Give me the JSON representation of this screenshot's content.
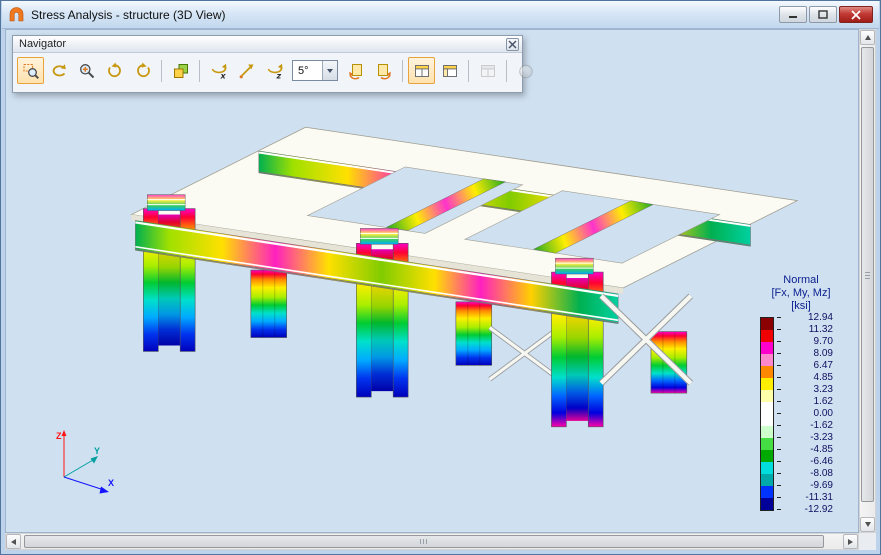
{
  "window": {
    "title": "Stress Analysis - structure (3D View)"
  },
  "navigator": {
    "title": "Navigator",
    "angle_value": "5°",
    "rotate_x_label": "x",
    "rotate_z_label": "z",
    "buttons": [
      {
        "name": "zoom-window",
        "state": "active"
      },
      {
        "name": "orbit",
        "state": "normal"
      },
      {
        "name": "zoom-in",
        "state": "normal"
      },
      {
        "name": "rotate-view-ccw",
        "state": "normal"
      },
      {
        "name": "rotate-view-cw",
        "state": "normal"
      },
      {
        "name": "display-layers",
        "state": "normal"
      },
      {
        "name": "rotate-about-x",
        "state": "normal"
      },
      {
        "name": "free-rotation",
        "state": "normal"
      },
      {
        "name": "rotate-about-z",
        "state": "normal"
      },
      {
        "name": "rotation-angle",
        "state": "normal",
        "value": "5°"
      },
      {
        "name": "rotate-left",
        "state": "normal"
      },
      {
        "name": "rotate-right",
        "state": "normal"
      },
      {
        "name": "view-isometric",
        "state": "active"
      },
      {
        "name": "view-parallel",
        "state": "normal"
      },
      {
        "name": "view-plane",
        "state": "disabled"
      },
      {
        "name": "full-model-view",
        "state": "disabled"
      }
    ]
  },
  "legend": {
    "title_line1": "Normal",
    "title_line2": "[Fx, My, Mz]",
    "title_line3": "[ksi]",
    "values": [
      "12.94",
      "11.32",
      "9.70",
      "8.09",
      "6.47",
      "4.85",
      "3.23",
      "1.62",
      "0.00",
      "-1.62",
      "-3.23",
      "-4.85",
      "-6.46",
      "-8.08",
      "-9.69",
      "-11.31",
      "-12.92"
    ],
    "band_colors": [
      "#8b0000",
      "#f00000",
      "#ff00cc",
      "#ff88cc",
      "#ff8800",
      "#ffee00",
      "#ffffaa",
      "#ffffff",
      "#ffffff",
      "#ccffcc",
      "#44dd44",
      "#00aa00",
      "#00dddd",
      "#00aaaa",
      "#0033ff",
      "#000099"
    ]
  },
  "axes": {
    "x_label": "X",
    "y_label": "Y",
    "z_label": "Z",
    "x_color": "#1414ff",
    "y_color": "#00a0a0",
    "z_color": "#ff1414"
  },
  "colors": {
    "canvas_bg": "#cfe0f1",
    "active_button_border": "#e8a33d",
    "legend_text": "#0a1f8f"
  }
}
